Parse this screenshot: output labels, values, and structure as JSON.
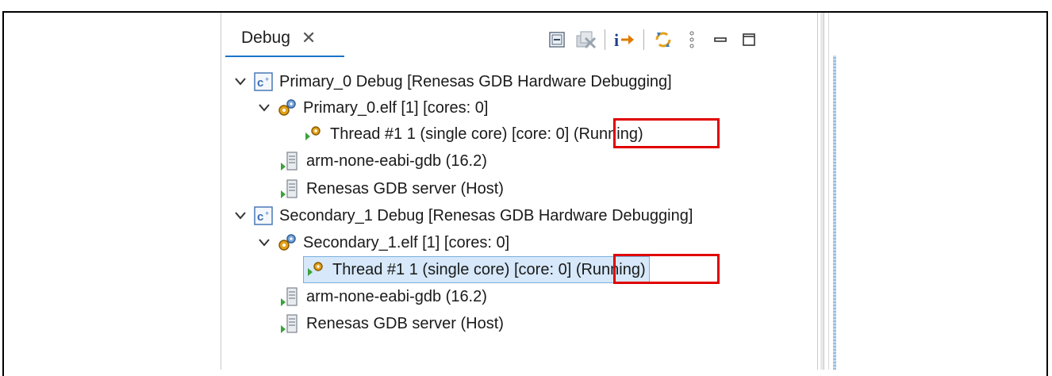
{
  "debug_view": {
    "tab_label": "Debug",
    "tree": {
      "sessions": [
        {
          "label": "Primary_0 Debug [Renesas GDB Hardware Debugging]",
          "elf": "Primary_0.elf [1] [cores: 0]",
          "thread_prefix": "Thread #1 1 (single core) [core: 0]",
          "thread_state": "(Running)",
          "gdb": "arm-none-eabi-gdb (16.2)",
          "server": "Renesas GDB server (Host)"
        },
        {
          "label": "Secondary_1 Debug [Renesas GDB Hardware Debugging]",
          "elf": "Secondary_1.elf [1] [cores: 0]",
          "thread_prefix": "Thread #1 1 (single core) [core: 0]",
          "thread_state": "(Running)",
          "gdb": "arm-none-eabi-gdb (16.2)",
          "server": "Renesas GDB server (Host)"
        }
      ]
    }
  },
  "colors": {
    "highlight": "#e00000",
    "selection": "#d6e8f9",
    "tab_underline": "#1a73c9"
  }
}
